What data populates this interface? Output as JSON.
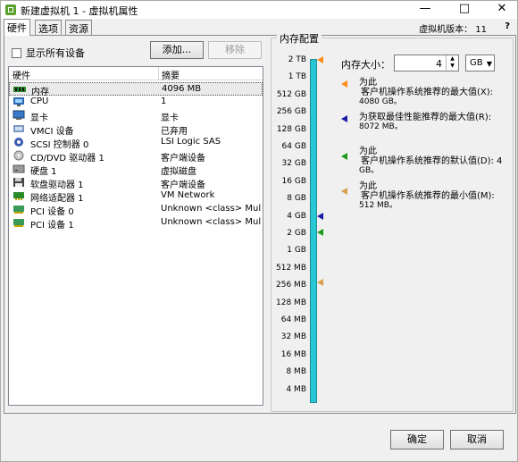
{
  "window": {
    "title": "新建虚拟机 1 - 虚拟机属性",
    "controls": [
      "—",
      "□",
      "✕"
    ]
  },
  "tabs": [
    {
      "label": "硬件",
      "active": true
    },
    {
      "label": "选项",
      "active": false
    },
    {
      "label": "资源",
      "active": false
    }
  ],
  "version_label": "虚拟机版本： 11",
  "hardware": {
    "show_all_label": "显示所有设备",
    "add_button": "添加...",
    "remove_button": "移除",
    "columns": [
      "硬件",
      "摘要"
    ],
    "rows": [
      {
        "icon": "memory-icon",
        "name": "内存",
        "summary": "4096 MB",
        "selected": true
      },
      {
        "icon": "cpu-icon",
        "name": "CPU",
        "summary": "1"
      },
      {
        "icon": "video-card-icon",
        "name": "显卡",
        "summary": "显卡"
      },
      {
        "icon": "vmci-icon",
        "name": "VMCI 设备",
        "summary": "已弃用"
      },
      {
        "icon": "scsi-controller-icon",
        "name": "SCSI 控制器 0",
        "summary": "LSI Logic SAS"
      },
      {
        "icon": "cd-dvd-icon",
        "name": "CD/DVD 驱动器 1",
        "summary": "客户端设备"
      },
      {
        "icon": "hard-disk-icon",
        "name": "硬盘 1",
        "summary": "虚拟磁盘"
      },
      {
        "icon": "floppy-icon",
        "name": "软盘驱动器 1",
        "summary": "客户端设备"
      },
      {
        "icon": "network-adapter-icon",
        "name": "网络适配器 1",
        "summary": "VM Network"
      },
      {
        "icon": "pci-icon",
        "name": "PCI 设备 0",
        "summary": "Unknown <class> Mult..."
      },
      {
        "icon": "pci-icon",
        "name": "PCI 设备 1",
        "summary": "Unknown <class> Mult..."
      }
    ]
  },
  "memory": {
    "group_title": "内存配置",
    "size_label": "内存大小：",
    "size_value": "4",
    "unit_value": "GB",
    "scale_labels": [
      "2 TB",
      "1 TB",
      "512 GB",
      "256 GB",
      "128 GB",
      "64 GB",
      "32 GB",
      "16 GB",
      "8 GB",
      "4 GB",
      "2 GB",
      "1 GB",
      "512 MB",
      "256 MB",
      "128 MB",
      "64 MB",
      "32 MB",
      "16 MB",
      "8 MB",
      "4 MB"
    ],
    "legend": [
      {
        "color": "#ff8c1a",
        "line1": "为此",
        "line2": "客户机操作系统推荐的最大值(X):",
        "line3": "4080 GB。"
      },
      {
        "color": "#1a1aa8",
        "line1": "为获取最佳性能推荐的最大值(R):",
        "line2": "8072 MB。",
        "line3": ""
      },
      {
        "color": "#1a9a1a",
        "line1": "为此",
        "line2": "客户机操作系统推荐的默认值(D): 4",
        "line3": "GB。"
      },
      {
        "color": "#d8a04a",
        "line1": "为此",
        "line2": "客户机操作系统推荐的最小值(M):",
        "line3": "512 MB。"
      }
    ]
  },
  "footer": {
    "ok_button": "确定",
    "cancel_button": "取消"
  }
}
